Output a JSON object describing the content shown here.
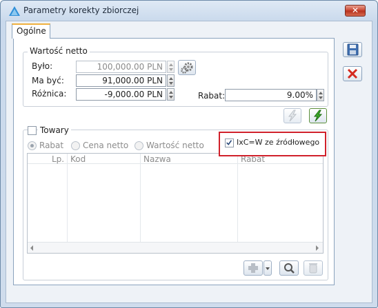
{
  "window": {
    "title": "Parametry korekty zbiorczej",
    "close_label": "✕"
  },
  "tabs": [
    {
      "label": "Ogólne"
    }
  ],
  "wartosc_netto": {
    "legend": "Wartość netto",
    "bylo_label": "Było:",
    "bylo_value": "100,000.00 PLN",
    "ma_byc_label": "Ma być:",
    "ma_byc_value": "91,000.00 PLN",
    "roznica_label": "Różnica:",
    "roznica_value": "-9,000.00 PLN",
    "rabat_label": "Rabat:",
    "rabat_value": "9.00%"
  },
  "towary": {
    "label": "Towary",
    "checked": false,
    "radios": [
      {
        "label": "Rabat",
        "selected": true
      },
      {
        "label": "Cena netto",
        "selected": false
      },
      {
        "label": "Wartość netto",
        "selected": false
      }
    ],
    "ixcw_label": "IxC=W ze źródłowego",
    "ixcw_checked": true,
    "columns": [
      "Lp.",
      "Kod",
      "Nazwa",
      "Rabat"
    ],
    "rows": []
  },
  "icons": {
    "settings": "gear-icon",
    "calc_disabled": "lightning-icon",
    "calc_active": "lightning-icon",
    "add": "plus-icon",
    "search": "magnifier-icon",
    "delete": "trash-icon",
    "save": "floppy-icon",
    "cancel": "red-x-icon"
  },
  "colors": {
    "highlight_border": "#d0202a",
    "green_action": "#3aa82a",
    "close_red": "#c8422e"
  }
}
